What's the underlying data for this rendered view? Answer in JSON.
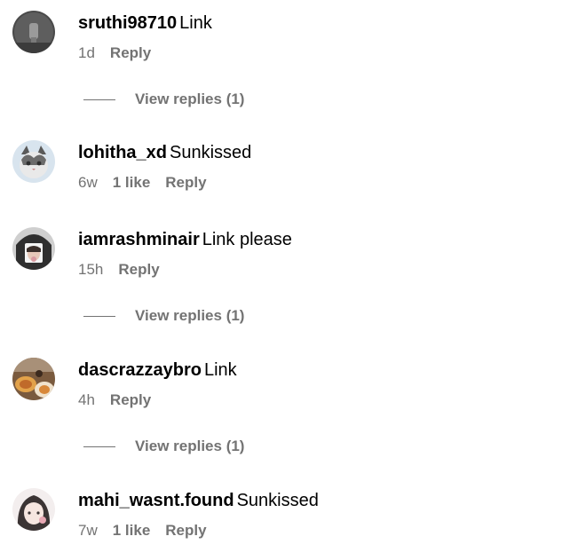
{
  "comments": [
    {
      "username": "sruthi98710",
      "text": "Link",
      "time": "1d",
      "likes": "",
      "reply_label": "Reply",
      "view_replies": "View replies (1)",
      "avatar_icon": "user-avatar-dark-icon"
    },
    {
      "username": "lohitha_xd",
      "text": "Sunkissed",
      "time": "6w",
      "likes": "1 like",
      "reply_label": "Reply",
      "view_replies": "",
      "avatar_icon": "user-avatar-cat-icon"
    },
    {
      "username": "iamrashminair",
      "text": "Link please",
      "time": "15h",
      "likes": "",
      "reply_label": "Reply",
      "view_replies": "View replies (1)",
      "avatar_icon": "user-avatar-portrait-icon"
    },
    {
      "username": "dascrazzaybro",
      "text": "Link",
      "time": "4h",
      "likes": "",
      "reply_label": "Reply",
      "view_replies": "View replies (1)",
      "avatar_icon": "user-avatar-food-icon"
    },
    {
      "username": "mahi_wasnt.found",
      "text": "Sunkissed",
      "time": "7w",
      "likes": "1 like",
      "reply_label": "Reply",
      "view_replies": "",
      "avatar_icon": "user-avatar-anime-icon"
    }
  ],
  "colors": {
    "text_primary": "#000000",
    "text_secondary": "#737373",
    "background": "#ffffff"
  }
}
